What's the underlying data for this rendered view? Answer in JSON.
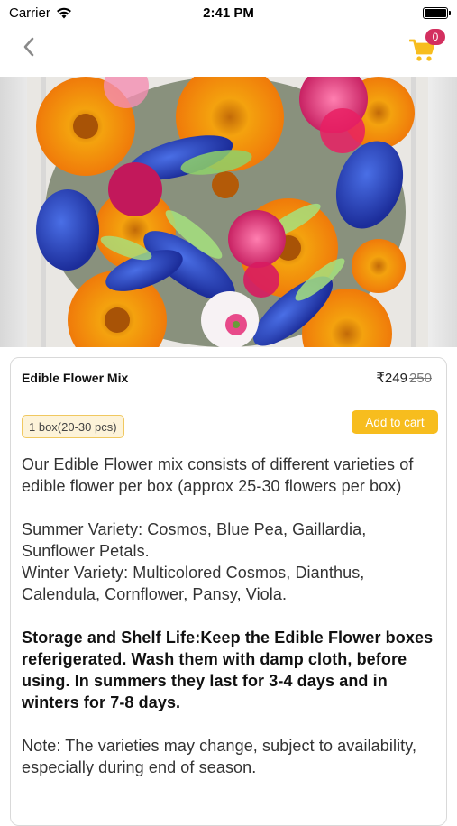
{
  "status_bar": {
    "carrier": "Carrier",
    "time": "2:41 PM"
  },
  "nav": {
    "cart_count": "0",
    "accent_color": "#f7bd1e",
    "badge_color": "#d32f5f"
  },
  "product": {
    "name": "Edible Flower Mix",
    "price": "₹249",
    "mrp": "250",
    "variant": "1 box(20-30 pcs)",
    "add_to_cart_label": "Add to cart",
    "description": {
      "intro": "Our Edible Flower mix consists of different varieties of edible flower per box (approx 25-30  flowers per box)",
      "summer": "Summer Variety: Cosmos, Blue Pea, Gaillardia, Sunflower Petals.",
      "winter": "Winter Variety: Multicolored Cosmos, Dianthus, Calendula, Cornflower, Pansy, Viola.",
      "storage": "Storage and Shelf Life:Keep the Edible Flower boxes referigerated. Wash them with damp cloth, before using. In summers they last for 3-4 days and in winters for 7-8 days.",
      "note": "Note: The varieties may change, subject to availability, especially during end of season."
    }
  },
  "icons": {
    "back": "chevron-left-icon",
    "cart": "shopping-cart-icon",
    "wifi": "wifi-icon",
    "battery": "battery-icon"
  }
}
